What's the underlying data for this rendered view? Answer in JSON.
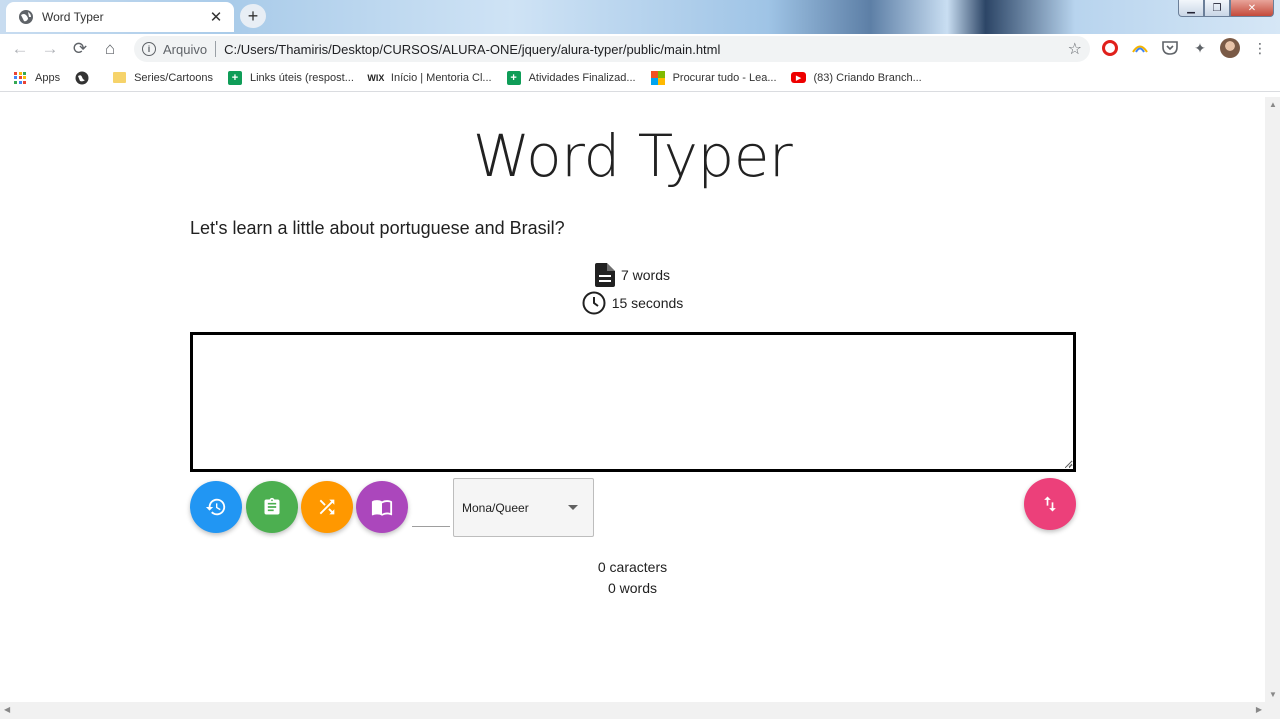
{
  "browser": {
    "tab": {
      "title": "Word Typer",
      "close": "✕"
    },
    "new_tab": "+",
    "window_buttons": {
      "minimize": "▁",
      "maximize": "❐",
      "close": "✕"
    },
    "nav": {
      "back": "←",
      "forward": "→",
      "reload": "⟳",
      "home": "⌂"
    },
    "omnibox": {
      "info": "i",
      "security_label": "Arquivo",
      "url": "C:/Users/Thamiris/Desktop/CURSOS/ALURA-ONE/jquery/alura-typer/public/main.html",
      "star": "☆"
    },
    "extensions": {
      "puzzle": "✦",
      "menu": "⋮"
    },
    "bookmarks": [
      {
        "label": "Apps",
        "icon": "apps-grid-icon"
      },
      {
        "label": "",
        "icon": "globe-icon"
      },
      {
        "label": "Series/Cartoons",
        "icon": "folder-icon"
      },
      {
        "label": "Links úteis (respost...",
        "icon": "sheets-icon"
      },
      {
        "label": "Início | Mentoria Cl...",
        "icon": "wix-icon"
      },
      {
        "label": "Atividades Finalizad...",
        "icon": "sheets-icon"
      },
      {
        "label": "Procurar tudo - Lea...",
        "icon": "microsoft-icon"
      },
      {
        "label": "(83) Criando Branch...",
        "icon": "youtube-icon"
      }
    ],
    "bookmark_wix_glyph": "WIX",
    "bookmark_sheet_glyph": "+",
    "bookmark_yt_glyph": "▶"
  },
  "page": {
    "title": "Word Typer",
    "phrase": "Let's learn a little about portuguese and Brasil?",
    "phrase_info": {
      "word_count": "7 words",
      "time": "15 seconds"
    },
    "typing_area": {
      "value": "",
      "placeholder": ""
    },
    "buttons": {
      "restart": "restart-icon",
      "scoreboard": "clipboard-icon",
      "random_phrase": "shuffle-icon",
      "phrase_picker": "book-icon",
      "sync": "swap-vertical-icon"
    },
    "phrase_id_input": {
      "value": ""
    },
    "select": {
      "selected": "Mona/Queer"
    },
    "counters": {
      "characters": "0 caracters",
      "words": "0 words"
    }
  },
  "colors": {
    "restart": "#2196f3",
    "scoreboard": "#4caf50",
    "random": "#ff9800",
    "picker": "#ab47bc",
    "sync": "#ec407a"
  }
}
